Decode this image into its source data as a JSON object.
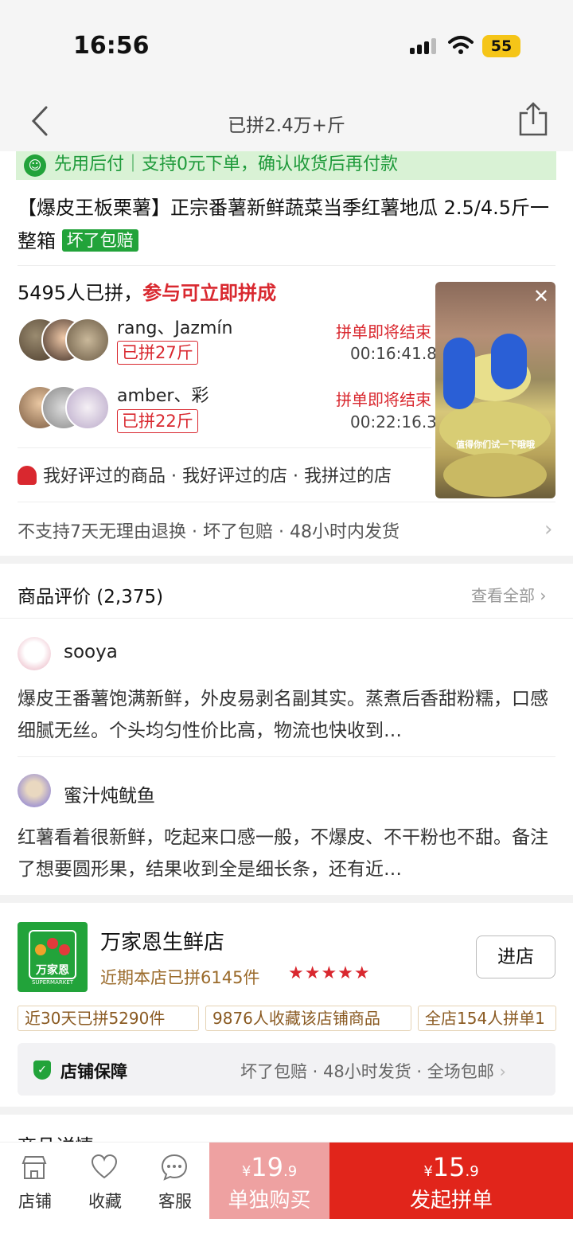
{
  "status_bar": {
    "time": "16:56",
    "battery": "55"
  },
  "nav": {
    "title": "已拼2.4万+斤"
  },
  "pay_banner": {
    "text": "先用后付｜支持0元下单，确认收货后再付款"
  },
  "product": {
    "title": "【爆皮王板栗薯】正宗番薯新鲜蔬菜当季红薯地瓜 2.5/4.5斤一整箱",
    "tag": "坏了包赔"
  },
  "group_buy": {
    "count_text": "5495人已拼，",
    "cta_text": "参与可立即拼成",
    "groups": [
      {
        "names": "rang、Jazmín",
        "badge": "已拼27斤",
        "ending": "拼单即将结束",
        "timer": "00:16:41.8"
      },
      {
        "names": "amber、彩",
        "badge": "已拼22斤",
        "ending": "拼单即将结束",
        "timer": "00:22:16.3"
      }
    ]
  },
  "video": {
    "caption": "值得你们试一下哦哦"
  },
  "shop_tags": "我好评过的商品 · 我好评过的店 · 我拼过的店",
  "service": "不支持7天无理由退换 · 坏了包赔 · 48小时内发货",
  "reviews": {
    "title": "商品评价 (2,375)",
    "view_all": "查看全部",
    "items": [
      {
        "user": "sooya",
        "text": "爆皮王番薯饱满新鲜，外皮易剥名副其实。蒸煮后香甜粉糯，口感细腻无丝。个头均匀性价比高，物流也快收到…"
      },
      {
        "user": "蜜汁炖鱿鱼",
        "text": "红薯看着很新鲜，吃起来口感一般，不爆皮、不干粉也不甜。备注了想要圆形果，结果收到全是细长条，还有近…"
      }
    ]
  },
  "store": {
    "logo_cn": "万家恩",
    "logo_en": "SUPERMARKET",
    "name": "万家恩生鲜店",
    "sold": "近期本店已拼6145件",
    "stars": "★★★★★",
    "enter": "进店",
    "stats": [
      "近30天已拼5290件",
      "9876人收藏该店铺商品",
      "全店154人拼单1"
    ],
    "guarantee_title": "店铺保障",
    "guarantee_items": "坏了包赔 · 48小时发货 · 全场包邮"
  },
  "detail_title": "商品详情",
  "bottom": {
    "tabs": [
      "店铺",
      "收藏",
      "客服"
    ],
    "single_price_symbol": "¥",
    "single_price_int": "19",
    "single_price_dec": ".9",
    "single_label": "单独购买",
    "group_price_symbol": "¥",
    "group_price_int": "15",
    "group_price_dec": ".9",
    "group_label": "发起拼单"
  }
}
